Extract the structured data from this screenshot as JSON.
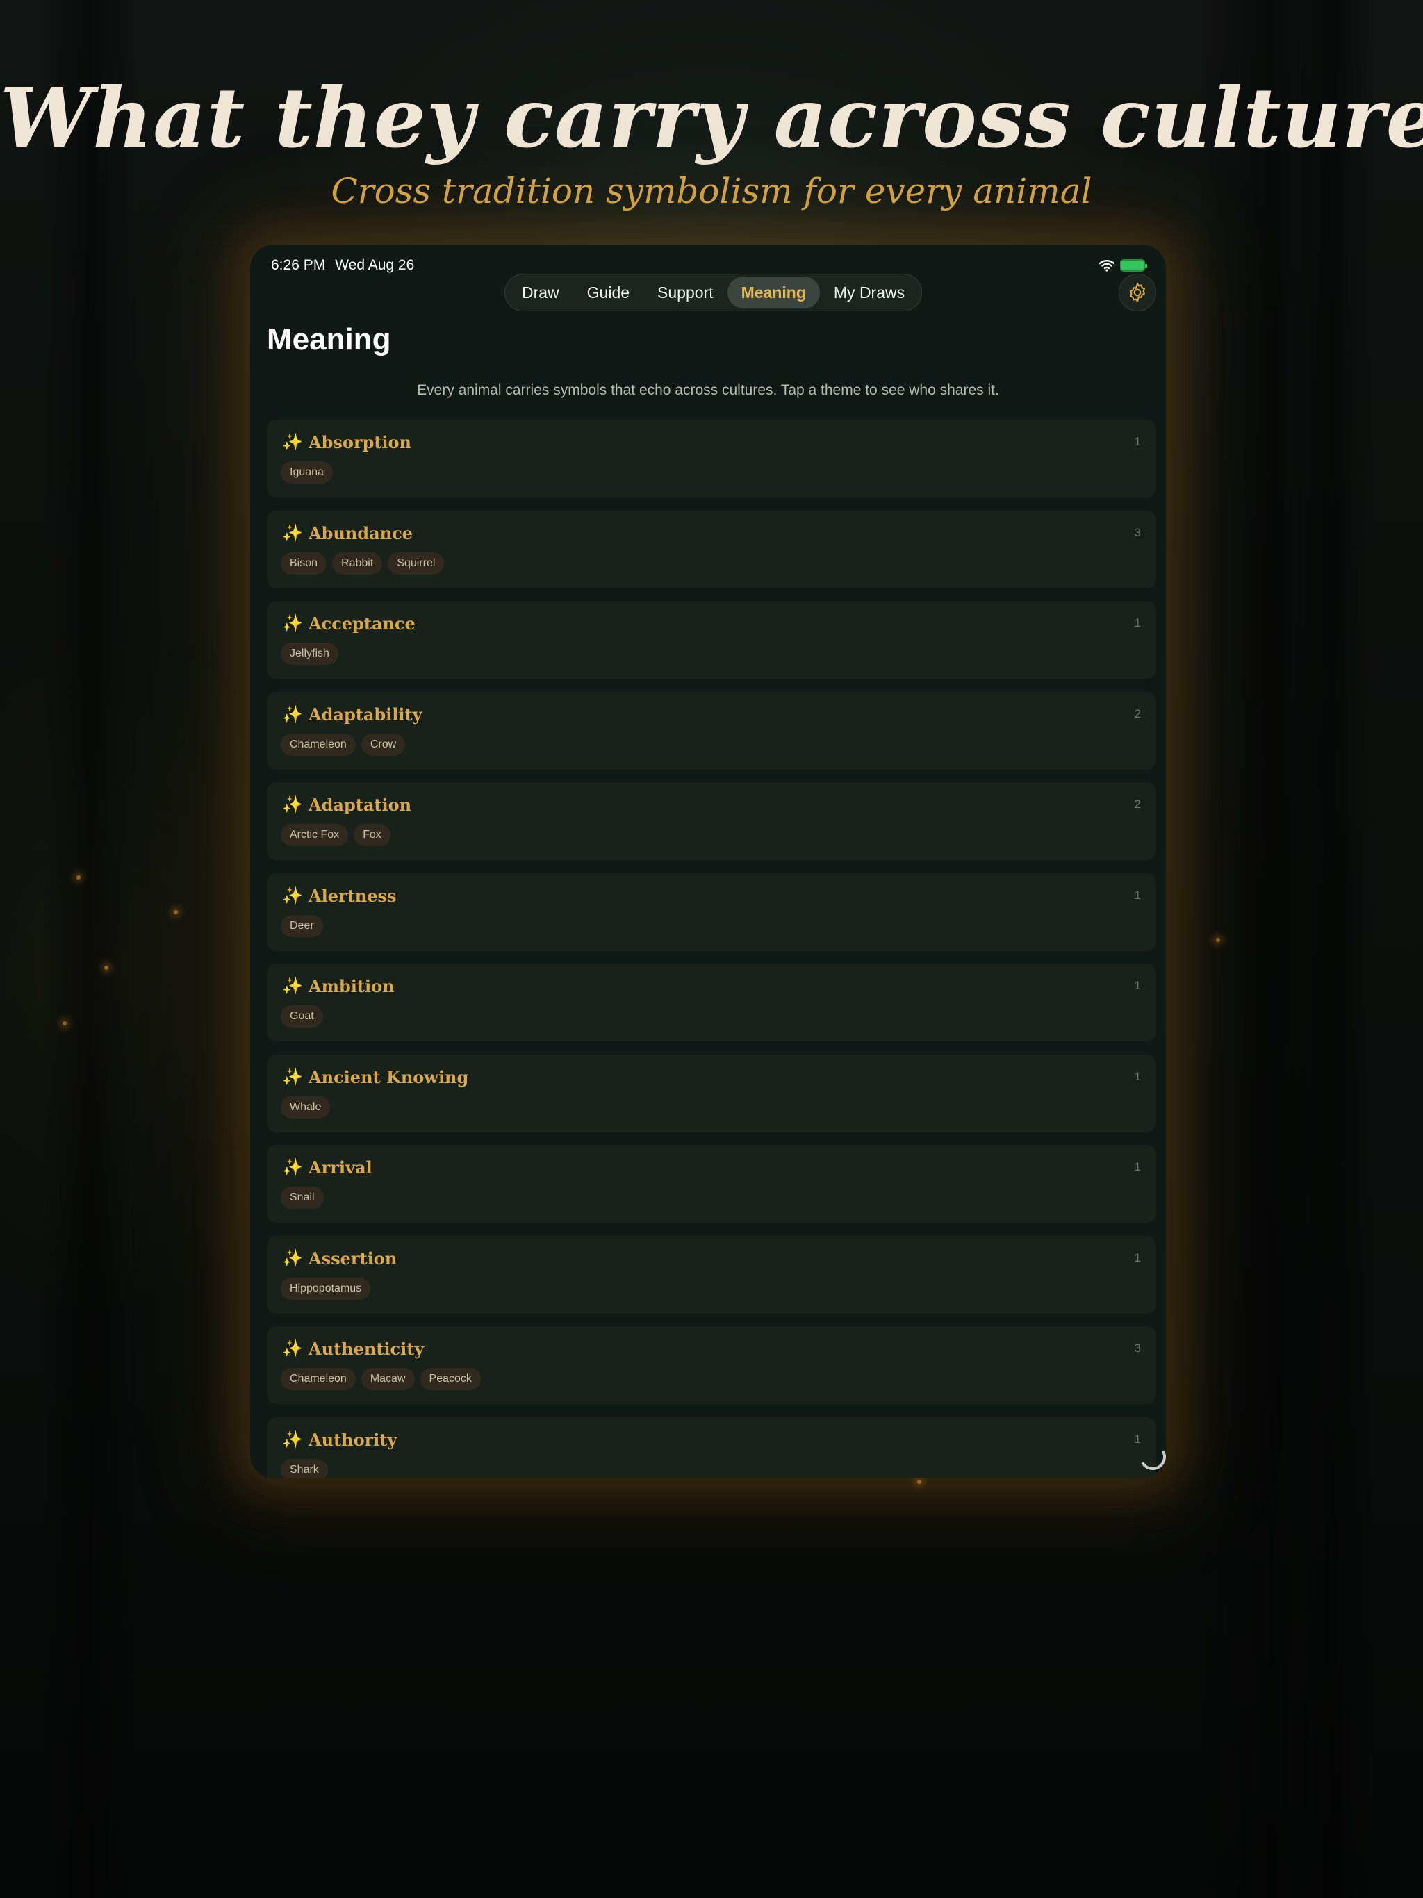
{
  "banner": {
    "headline": "What they carry across cultures",
    "subheadline": "Cross tradition symbolism for every animal"
  },
  "status_bar": {
    "time": "6:26 PM",
    "date": "Wed Aug 26",
    "icons": [
      "wifi-icon",
      "battery-charging-icon"
    ]
  },
  "nav": {
    "tabs": [
      {
        "label": "Draw",
        "active": false
      },
      {
        "label": "Guide",
        "active": false
      },
      {
        "label": "Support",
        "active": false
      },
      {
        "label": "Meaning",
        "active": true
      },
      {
        "label": "My Draws",
        "active": false
      }
    ],
    "settings_icon": "gear-icon"
  },
  "page": {
    "title": "Meaning",
    "intro": "Every animal carries symbols that echo across cultures. Tap a theme to see who shares it."
  },
  "themes": [
    {
      "name": "Absorption",
      "count": "1",
      "animals": [
        "Iguana"
      ]
    },
    {
      "name": "Abundance",
      "count": "3",
      "animals": [
        "Bison",
        "Rabbit",
        "Squirrel"
      ]
    },
    {
      "name": "Acceptance",
      "count": "1",
      "animals": [
        "Jellyfish"
      ]
    },
    {
      "name": "Adaptability",
      "count": "2",
      "animals": [
        "Chameleon",
        "Crow"
      ]
    },
    {
      "name": "Adaptation",
      "count": "2",
      "animals": [
        "Arctic Fox",
        "Fox"
      ]
    },
    {
      "name": "Alertness",
      "count": "1",
      "animals": [
        "Deer"
      ]
    },
    {
      "name": "Ambition",
      "count": "1",
      "animals": [
        "Goat"
      ]
    },
    {
      "name": "Ancient Knowing",
      "count": "1",
      "animals": [
        "Whale"
      ]
    },
    {
      "name": "Arrival",
      "count": "1",
      "animals": [
        "Snail"
      ]
    },
    {
      "name": "Assertion",
      "count": "1",
      "animals": [
        "Hippopotamus"
      ]
    },
    {
      "name": "Authenticity",
      "count": "3",
      "animals": [
        "Chameleon",
        "Macaw",
        "Peacock"
      ]
    },
    {
      "name": "Authority",
      "count": "1",
      "animals": [
        "Shark"
      ]
    }
  ],
  "theme_icon": "✨",
  "colors": {
    "accent_gold": "#d9a84c",
    "active_tab_text": "#e2b556",
    "card_background": "#18221b",
    "device_background": "#0f1a16",
    "chip_background": "#302a1e"
  }
}
